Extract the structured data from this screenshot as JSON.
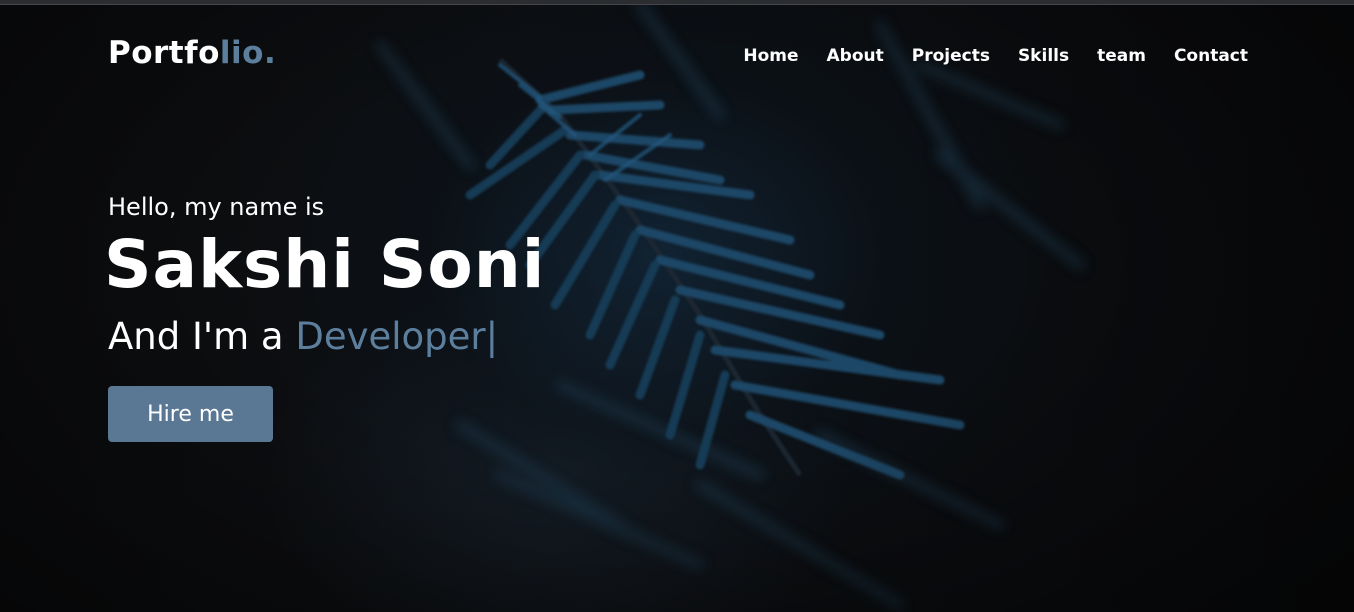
{
  "header": {
    "logo_main": "Portfo",
    "logo_accent": "lio."
  },
  "nav": {
    "items": [
      "Home",
      "About",
      "Projects",
      "Skills",
      "team",
      "Contact"
    ]
  },
  "hero": {
    "greeting": "Hello, my name is",
    "name": "Sakshi Soni",
    "role_prefix": "And I'm a ",
    "role_typed": "Developer",
    "cursor": "|",
    "cta_label": "Hire me"
  },
  "colors": {
    "accent": "#5d7f9e",
    "button": "#5a7894",
    "background": "#0e0f11"
  }
}
